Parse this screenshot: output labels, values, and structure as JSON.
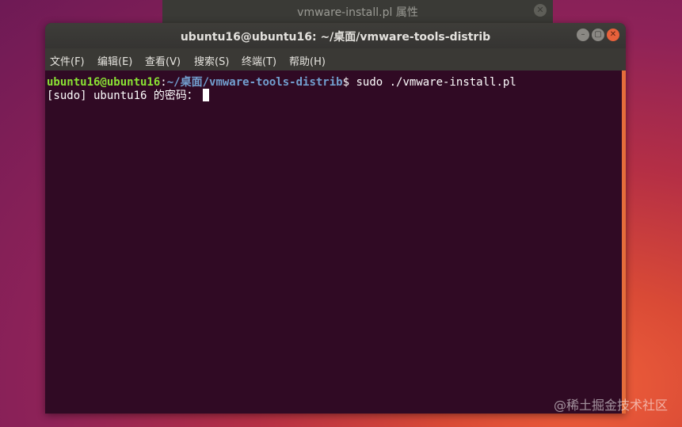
{
  "back_window": {
    "title": "vmware-install.pl 属性",
    "close_glyph": "✕"
  },
  "terminal": {
    "title": "ubuntu16@ubuntu16: ~/桌面/vmware-tools-distrib",
    "buttons": {
      "minimize": "–",
      "maximize": "▢",
      "close": "✕"
    },
    "menu": [
      {
        "label": "文件(F)"
      },
      {
        "label": "编辑(E)"
      },
      {
        "label": "查看(V)"
      },
      {
        "label": "搜索(S)"
      },
      {
        "label": "终端(T)"
      },
      {
        "label": "帮助(H)"
      }
    ],
    "prompt": {
      "user_host": "ubuntu16@ubuntu16",
      "colon": ":",
      "path": "~/桌面/vmware-tools-distrib",
      "suffix": "$ ",
      "command": "sudo ./vmware-install.pl"
    },
    "password_prompt": "[sudo] ubuntu16 的密码："
  },
  "watermark": "@稀土掘金技术社区",
  "colors": {
    "terminal_bg": "#300a24",
    "prompt_user": "#8ae234",
    "prompt_path": "#729fcf",
    "close_button": "#e7613b",
    "scrollbar": "#e46d3b"
  }
}
